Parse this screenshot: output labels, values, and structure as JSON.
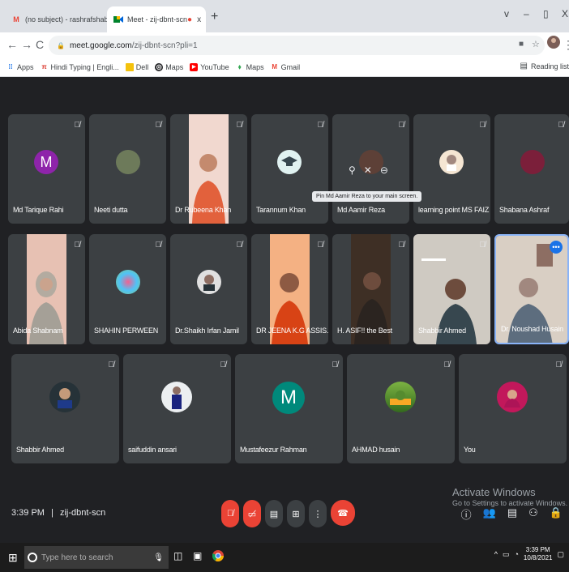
{
  "browser": {
    "tabs": [
      {
        "title": "(no subject) - rashrafshabana@gma",
        "favicon": "gmail-icon",
        "close": "x"
      },
      {
        "title": "Meet - zij-dbnt-scn",
        "favicon": "meet-icon",
        "close": "x",
        "recording_dot": "●"
      }
    ],
    "new_tab": "+",
    "window_controls": {
      "dropdown": "v",
      "minimize": "–",
      "restore": "▯",
      "close": "X"
    },
    "url": {
      "domain": "meet.google.com",
      "path": "/zij-dbnt-scn?pli=1"
    },
    "bookmarks": [
      {
        "label": "Apps",
        "icon": "apps-grid-icon"
      },
      {
        "label": "Hindi Typing | Engli...",
        "icon": "typing-icon"
      },
      {
        "label": "Dell",
        "icon": "folder-icon"
      },
      {
        "label": "Maps",
        "icon": "maps-icon"
      },
      {
        "label": "YouTube",
        "icon": "youtube-icon"
      },
      {
        "label": "Maps",
        "icon": "maps-pin-icon"
      },
      {
        "label": "Gmail",
        "icon": "gmail-icon"
      }
    ],
    "reading_list": "Reading list"
  },
  "meet": {
    "participants": [
      {
        "name": "Md Tarique Rahi",
        "type": "avatar",
        "initial": "M",
        "color": "#8e24aa"
      },
      {
        "name": "Neeti dutta",
        "type": "photo"
      },
      {
        "name": "Dr Rubeena Khan",
        "type": "video"
      },
      {
        "name": "Tarannum Khan",
        "type": "photo"
      },
      {
        "name": "Md Aamir Reza",
        "type": "photo"
      },
      {
        "name": "learning point MS FAIZ",
        "type": "photo"
      },
      {
        "name": "Shabana Ashraf",
        "type": "photo"
      },
      {
        "name": "Abida Shabnam",
        "type": "video"
      },
      {
        "name": "SHAHIN PERWEEN",
        "type": "photo"
      },
      {
        "name": "Dr.Shaikh Irfan Jamil",
        "type": "photo"
      },
      {
        "name": "DR JEENA K.G ASSIS...",
        "type": "video"
      },
      {
        "name": "H. ASIF!! the Best",
        "type": "video"
      },
      {
        "name": "Shabbir Ahmed",
        "type": "video"
      },
      {
        "name": "Dr. Noushad Husain",
        "type": "video"
      },
      {
        "name": "Shabbir Ahmed",
        "type": "photo"
      },
      {
        "name": "saifuddin ansari",
        "type": "photo"
      },
      {
        "name": "Mustafeezur Rahman",
        "type": "avatar",
        "initial": "M",
        "color": "#00897b"
      },
      {
        "name": "AHMAD husain",
        "type": "photo"
      },
      {
        "name": "You",
        "type": "photo"
      }
    ],
    "tooltip": "Pin Md Aamir Reza to your main screen.",
    "time": "3:39 PM",
    "separator": "|",
    "meeting_code": "zij-dbnt-scn",
    "more_options": "•••"
  },
  "watermark": {
    "line1": "Activate Windows",
    "line2": "Go to Settings to activate Windows."
  },
  "taskbar": {
    "search_placeholder": "Type here to search",
    "time": "3:39 PM",
    "date": "10/8/2021"
  },
  "colors": {
    "meet_bg": "#202124",
    "tile_bg": "#3c4043",
    "end_call": "#ea4335",
    "accent": "#1a73e8"
  }
}
